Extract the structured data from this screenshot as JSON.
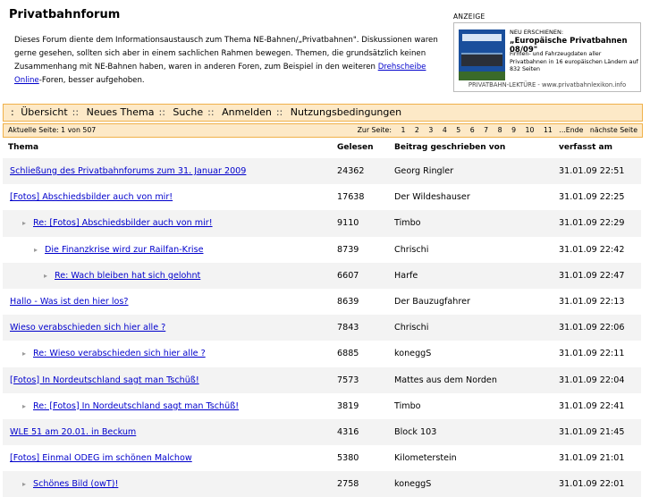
{
  "header": {
    "title": "Privatbahnforum",
    "intro_text": "Dieses Forum diente dem Informationsaustausch zum Thema NE-Bahnen/„Privatbahnen\". Diskussionen waren gerne gesehen, sollten sich aber in einem sachlichen Rahmen bewegen. Themen, die grundsätzlich keinen Zusammenhang mit NE-Bahnen haben, waren in anderen Foren, zum Beispiel in den weiteren ",
    "intro_link": "Drehscheibe Online",
    "intro_tail": "-Foren, besser aufgehoben."
  },
  "ad": {
    "label": "ANZEIGE",
    "head": "NEU ERSCHIENEN:",
    "product": "„Europäische Privatbahnen 08/09\"",
    "desc": "Firmen- und Fahrzeugdaten aller Privatbahnen in 16 europäischen Ländern auf 832 Seiten",
    "footer": "PRIVATBAHN-LEKTÜRE - www.privatbahnlexikon.info"
  },
  "nav": {
    "lead": ":",
    "items": [
      "Übersicht",
      "Neues Thema",
      "Suche",
      "Anmelden",
      "Nutzungsbedingungen"
    ],
    "sep": "::"
  },
  "pagination": {
    "current": "Aktuelle Seite: 1 von 507",
    "label": "Zur Seite:",
    "pages": [
      "1",
      "2",
      "3",
      "4",
      "5",
      "6",
      "7",
      "8",
      "9",
      "10",
      "11"
    ],
    "end": "...Ende",
    "next": "nächste Seite"
  },
  "table": {
    "headers": {
      "thema": "Thema",
      "gelesen": "Gelesen",
      "author": "Beitrag geschrieben von",
      "date": "verfasst am"
    },
    "rows": [
      {
        "title": "Schließung des Privatbahnforums zum 31. Januar 2009",
        "reads": "24362",
        "author": "Georg Ringler",
        "date": "31.01.09 22:51",
        "depth": 0
      },
      {
        "title": "[Fotos] Abschiedsbilder auch von mir!",
        "reads": "17638",
        "author": "Der Wildeshauser",
        "date": "31.01.09 22:25",
        "depth": 0
      },
      {
        "title": "Re: [Fotos] Abschiedsbilder auch von mir!",
        "reads": "9110",
        "author": "Timbo",
        "date": "31.01.09 22:29",
        "depth": 1
      },
      {
        "title": "Die Finanzkrise wird zur Railfan-Krise",
        "reads": "8739",
        "author": "Chrischi",
        "date": "31.01.09 22:42",
        "depth": 2
      },
      {
        "title": "Re: Wach bleiben hat sich gelohnt",
        "reads": "6607",
        "author": "Harfe",
        "date": "31.01.09 22:47",
        "depth": 3
      },
      {
        "title": "Hallo - Was ist den hier los?",
        "reads": "8639",
        "author": "Der Bauzugfahrer",
        "date": "31.01.09 22:13",
        "depth": 0
      },
      {
        "title": "Wieso verabschieden sich hier alle ?",
        "reads": "7843",
        "author": "Chrischi",
        "date": "31.01.09 22:06",
        "depth": 0
      },
      {
        "title": "Re: Wieso verabschieden sich hier alle ?",
        "reads": "6885",
        "author": "koneggS",
        "date": "31.01.09 22:11",
        "depth": 1
      },
      {
        "title": "[Fotos] In Nordeutschland sagt man Tschüß!",
        "reads": "7573",
        "author": "Mattes aus dem Norden",
        "date": "31.01.09 22:04",
        "depth": 0
      },
      {
        "title": "Re: [Fotos] In Nordeutschland sagt man Tschüß!",
        "reads": "3819",
        "author": "Timbo",
        "date": "31.01.09 22:41",
        "depth": 1
      },
      {
        "title": "WLE 51 am 20.01. in Beckum",
        "reads": "4316",
        "author": "Block 103",
        "date": "31.01.09 21:45",
        "depth": 0
      },
      {
        "title": "[Fotos] Einmal ODEG im schönen Malchow",
        "reads": "5380",
        "author": "Kilometerstein",
        "date": "31.01.09 21:01",
        "depth": 0
      },
      {
        "title": "Schönes Bild (owT)!",
        "reads": "2758",
        "author": "koneggS",
        "date": "31.01.09 22:01",
        "depth": 1
      }
    ]
  },
  "colors": {
    "nav_bg": "#fde9c7",
    "nav_border": "#f0b14a",
    "link": "#0000cc",
    "row_alt": "#f3f3f3"
  }
}
